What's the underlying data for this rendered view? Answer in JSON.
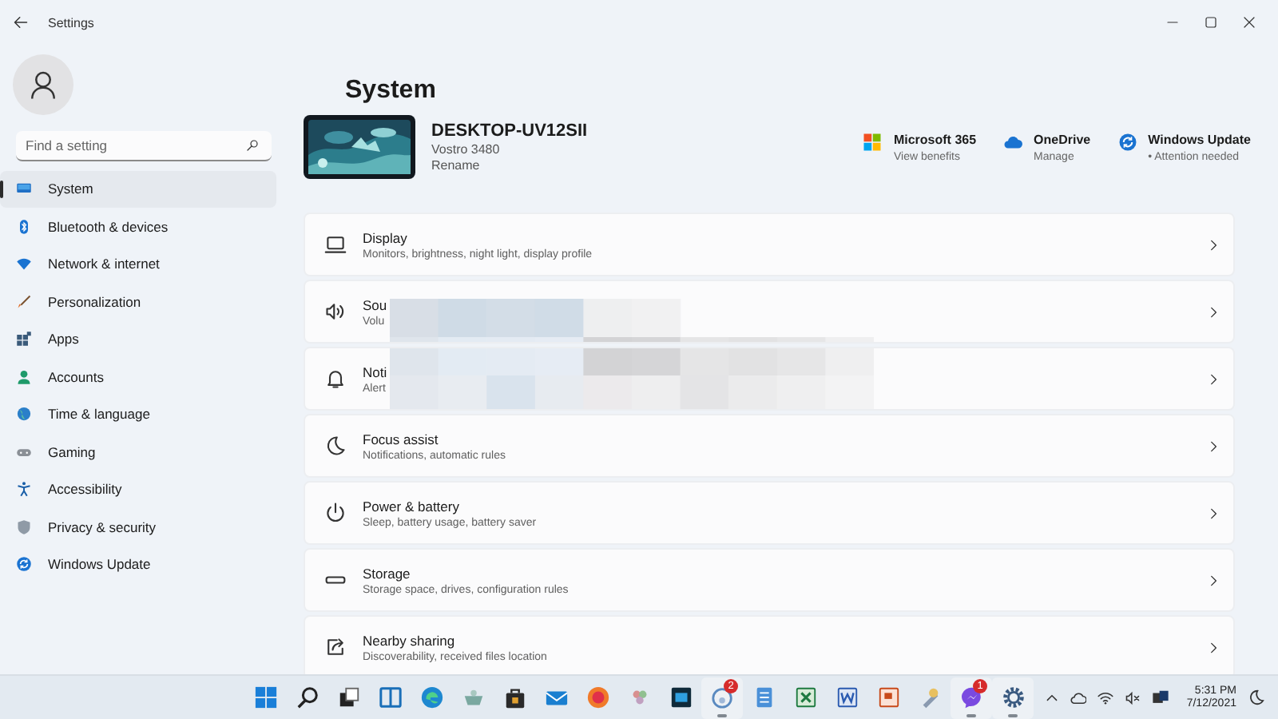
{
  "window": {
    "title": "Settings"
  },
  "sidebar": {
    "search": {
      "placeholder": "Find a setting"
    },
    "items": [
      {
        "label": "System",
        "selected": true
      },
      {
        "label": "Bluetooth & devices",
        "selected": false
      },
      {
        "label": "Network & internet",
        "selected": false
      },
      {
        "label": "Personalization",
        "selected": false
      },
      {
        "label": "Apps",
        "selected": false
      },
      {
        "label": "Accounts",
        "selected": false
      },
      {
        "label": "Time & language",
        "selected": false
      },
      {
        "label": "Gaming",
        "selected": false
      },
      {
        "label": "Accessibility",
        "selected": false
      },
      {
        "label": "Privacy & security",
        "selected": false
      },
      {
        "label": "Windows Update",
        "selected": false
      }
    ]
  },
  "header": {
    "title": "System"
  },
  "device": {
    "name": "DESKTOP-UV12SII",
    "model": "Vostro 3480",
    "action": "Rename"
  },
  "quick_links": [
    {
      "title": "Microsoft 365",
      "subtitle": "View benefits"
    },
    {
      "title": "OneDrive",
      "subtitle": "Manage"
    },
    {
      "title": "Windows Update",
      "subtitle": "• Attention needed"
    }
  ],
  "settings": [
    {
      "title": "Display",
      "subtitle": "Monitors, brightness, night light, display profile",
      "obscured": false
    },
    {
      "title": "Sou",
      "subtitle": "Volu",
      "obscured": true
    },
    {
      "title": "Noti",
      "subtitle": "Alert",
      "obscured": true
    },
    {
      "title": "Focus assist",
      "subtitle": "Notifications, automatic rules",
      "obscured": false
    },
    {
      "title": "Power & battery",
      "subtitle": "Sleep, battery usage, battery saver",
      "obscured": false
    },
    {
      "title": "Storage",
      "subtitle": "Storage space, drives, configuration rules",
      "obscured": false
    },
    {
      "title": "Nearby sharing",
      "subtitle": "Discoverability, received files location",
      "obscured": false
    }
  ],
  "taskbar": {
    "apps": [
      {
        "running": false
      },
      {
        "running": false
      },
      {
        "running": false
      },
      {
        "running": false
      },
      {
        "running": false
      },
      {
        "running": false
      },
      {
        "running": false
      },
      {
        "running": false
      },
      {
        "running": false
      },
      {
        "running": false
      },
      {
        "running": false
      },
      {
        "running": true,
        "badge": "2"
      },
      {
        "running": false
      },
      {
        "running": false
      },
      {
        "running": false
      },
      {
        "running": false
      },
      {
        "running": false
      },
      {
        "running": true,
        "badge": "1"
      },
      {
        "running": true
      }
    ],
    "time": "5:31 PM",
    "date": "7/12/2021"
  }
}
